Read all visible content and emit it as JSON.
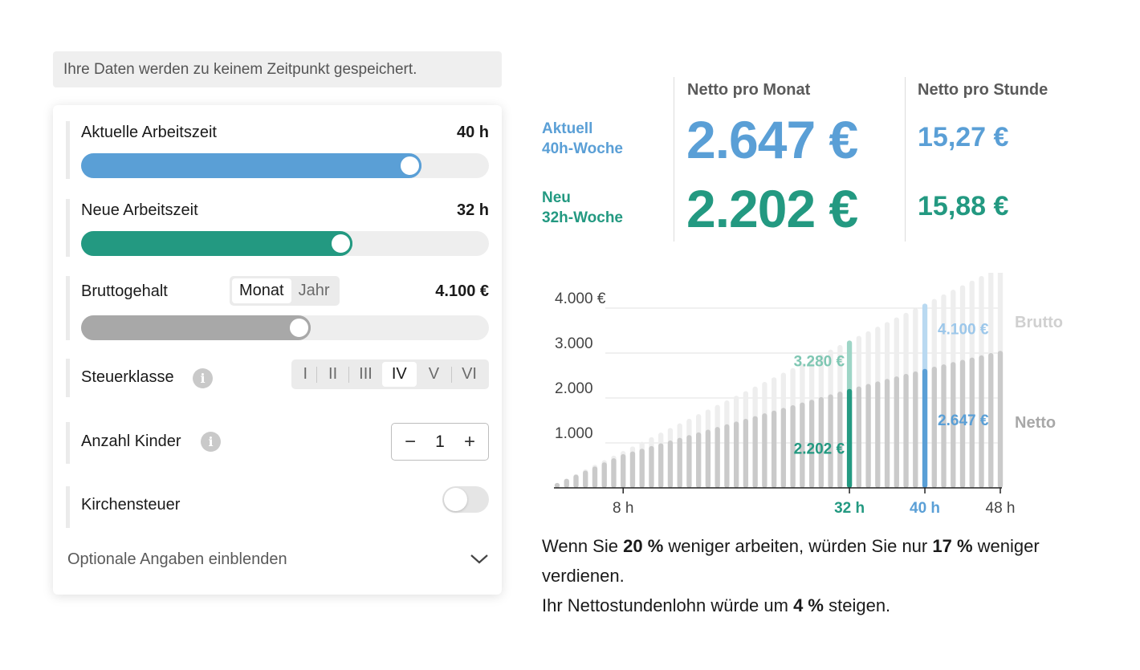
{
  "notice": "Ihre Daten werden zu keinem Zeitpunkt gespeichert.",
  "form": {
    "current_hours": {
      "label": "Aktuelle Arbeitszeit",
      "value": "40 h",
      "fraction": 0.806,
      "color": "#5a9fd6"
    },
    "new_hours": {
      "label": "Neue Arbeitszeit",
      "value": "32 h",
      "fraction": 0.637,
      "color": "#239981"
    },
    "gross": {
      "label": "Bruttogehalt",
      "value": "4.100 €",
      "fraction": 0.535,
      "color": "#a8a8a8",
      "period_options": [
        "Monat",
        "Jahr"
      ],
      "period_selected": "Monat"
    },
    "tax_class": {
      "label": "Steuerklasse",
      "options": [
        "I",
        "II",
        "III",
        "IV",
        "V",
        "VI"
      ],
      "selected": "IV"
    },
    "children": {
      "label": "Anzahl Kinder",
      "value": "1",
      "minus": "−",
      "plus": "+"
    },
    "church_tax": {
      "label": "Kirchensteuer",
      "enabled": false
    },
    "optional_toggle": "Optionale Angaben einblenden"
  },
  "summary": {
    "col_month": "Netto pro Monat",
    "col_hour": "Netto pro Stunde",
    "current": {
      "label_line1": "Aktuell",
      "label_line2": "40h-Woche",
      "monthly": "2.647 €",
      "hourly": "15,27 €"
    },
    "new": {
      "label_line1": "Neu",
      "label_line2": "32h-Woche",
      "monthly": "2.202 €",
      "hourly": "15,88 €"
    }
  },
  "chart_data": {
    "type": "bar",
    "x_range": [
      1,
      48
    ],
    "x_ticks": [
      "8 h",
      "32 h",
      "40 h",
      "48 h"
    ],
    "y_ticks": [
      "4.000 €",
      "3.000",
      "2.000",
      "1.000"
    ],
    "ylim": [
      0,
      4100
    ],
    "series_labels": {
      "gross": "Brutto",
      "net": "Netto"
    },
    "gross_per_hour": 102.5,
    "net_values_sample": {
      "8": 750,
      "32": 2202,
      "40": 2647,
      "48": 3050
    },
    "highlight": [
      {
        "hours": 32,
        "gross": 3280,
        "net": 2202,
        "gross_label": "3.280 €",
        "net_label": "2.202 €",
        "hours_label": "32 h"
      },
      {
        "hours": 40,
        "gross": 4100,
        "net": 2647,
        "gross_label": "4.100 €",
        "net_label": "2.647 €",
        "hours_label": "40 h"
      }
    ],
    "colors": {
      "gross": "#eeeeee",
      "net": "#cacaca",
      "green": "#239981",
      "green_light": "#9ed5c6",
      "blue": "#5a9fd6",
      "blue_light": "#b9d9f1"
    }
  },
  "text": {
    "p1_a": "Wenn Sie ",
    "p1_b": "20 %",
    "p1_c": " weniger arbeiten, würden Sie nur ",
    "p1_d": "17 %",
    "p1_e": " weniger verdienen.",
    "p2_a": "Ihr Nettostundenlohn würde um ",
    "p2_b": "4 %",
    "p2_c": " steigen."
  }
}
